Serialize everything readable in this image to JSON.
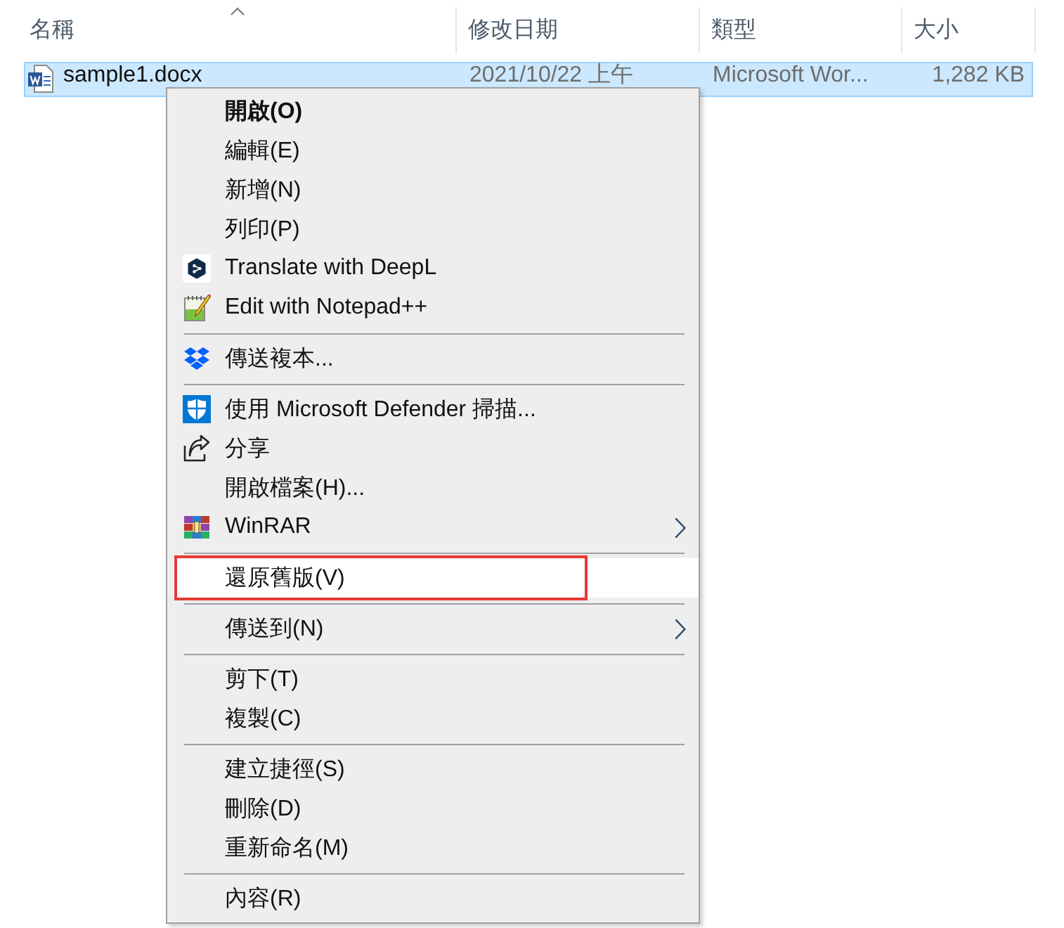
{
  "file_list": {
    "columns": [
      {
        "label": "名稱",
        "sorted": true
      },
      {
        "label": "修改日期",
        "sorted": false
      },
      {
        "label": "類型",
        "sorted": false
      },
      {
        "label": "大小",
        "sorted": false
      }
    ],
    "rows": [
      {
        "name": "sample1.docx",
        "modified": "2021/10/22 上午",
        "type": "Microsoft Wor...",
        "size": "1,282 KB",
        "selected": true
      }
    ]
  },
  "context_menu": {
    "groups": [
      {
        "items": [
          {
            "label": "開啟(O)",
            "default": true,
            "submenu": false,
            "selected": false,
            "outlined": false
          },
          {
            "label": "編輯(E)",
            "default": false,
            "submenu": false,
            "selected": false,
            "outlined": false
          },
          {
            "label": "新增(N)",
            "default": false,
            "submenu": false,
            "selected": false,
            "outlined": false
          },
          {
            "label": "列印(P)",
            "default": false,
            "submenu": false,
            "selected": false,
            "outlined": false
          },
          {
            "label": "Translate with DeepL",
            "default": false,
            "submenu": false,
            "selected": false,
            "outlined": false
          },
          {
            "label": "Edit with Notepad++",
            "default": false,
            "submenu": false,
            "selected": false,
            "outlined": false
          }
        ]
      },
      {
        "items": [
          {
            "label": "傳送複本...",
            "default": false,
            "submenu": false,
            "selected": false,
            "outlined": false
          }
        ]
      },
      {
        "items": [
          {
            "label": "使用 Microsoft Defender 掃描...",
            "default": false,
            "submenu": false,
            "selected": false,
            "outlined": false
          },
          {
            "label": "分享",
            "default": false,
            "submenu": false,
            "selected": false,
            "outlined": false
          },
          {
            "label": "開啟檔案(H)...",
            "default": false,
            "submenu": false,
            "selected": false,
            "outlined": false
          },
          {
            "label": "WinRAR",
            "default": false,
            "submenu": true,
            "selected": false,
            "outlined": false
          }
        ]
      },
      {
        "items": [
          {
            "label": "還原舊版(V)",
            "default": false,
            "submenu": false,
            "selected": true,
            "outlined": true
          }
        ]
      },
      {
        "items": [
          {
            "label": "傳送到(N)",
            "default": false,
            "submenu": true,
            "selected": false,
            "outlined": false
          }
        ]
      },
      {
        "items": [
          {
            "label": "剪下(T)",
            "default": false,
            "submenu": false,
            "selected": false,
            "outlined": false
          },
          {
            "label": "複製(C)",
            "default": false,
            "submenu": false,
            "selected": false,
            "outlined": false
          }
        ]
      },
      {
        "items": [
          {
            "label": "建立捷徑(S)",
            "default": false,
            "submenu": false,
            "selected": false,
            "outlined": false
          },
          {
            "label": "刪除(D)",
            "default": false,
            "submenu": false,
            "selected": false,
            "outlined": false
          },
          {
            "label": "重新命名(M)",
            "default": false,
            "submenu": false,
            "selected": false,
            "outlined": false
          }
        ]
      },
      {
        "items": [
          {
            "label": "內容(R)",
            "default": false,
            "submenu": false,
            "selected": false,
            "outlined": false
          }
        ]
      }
    ]
  }
}
